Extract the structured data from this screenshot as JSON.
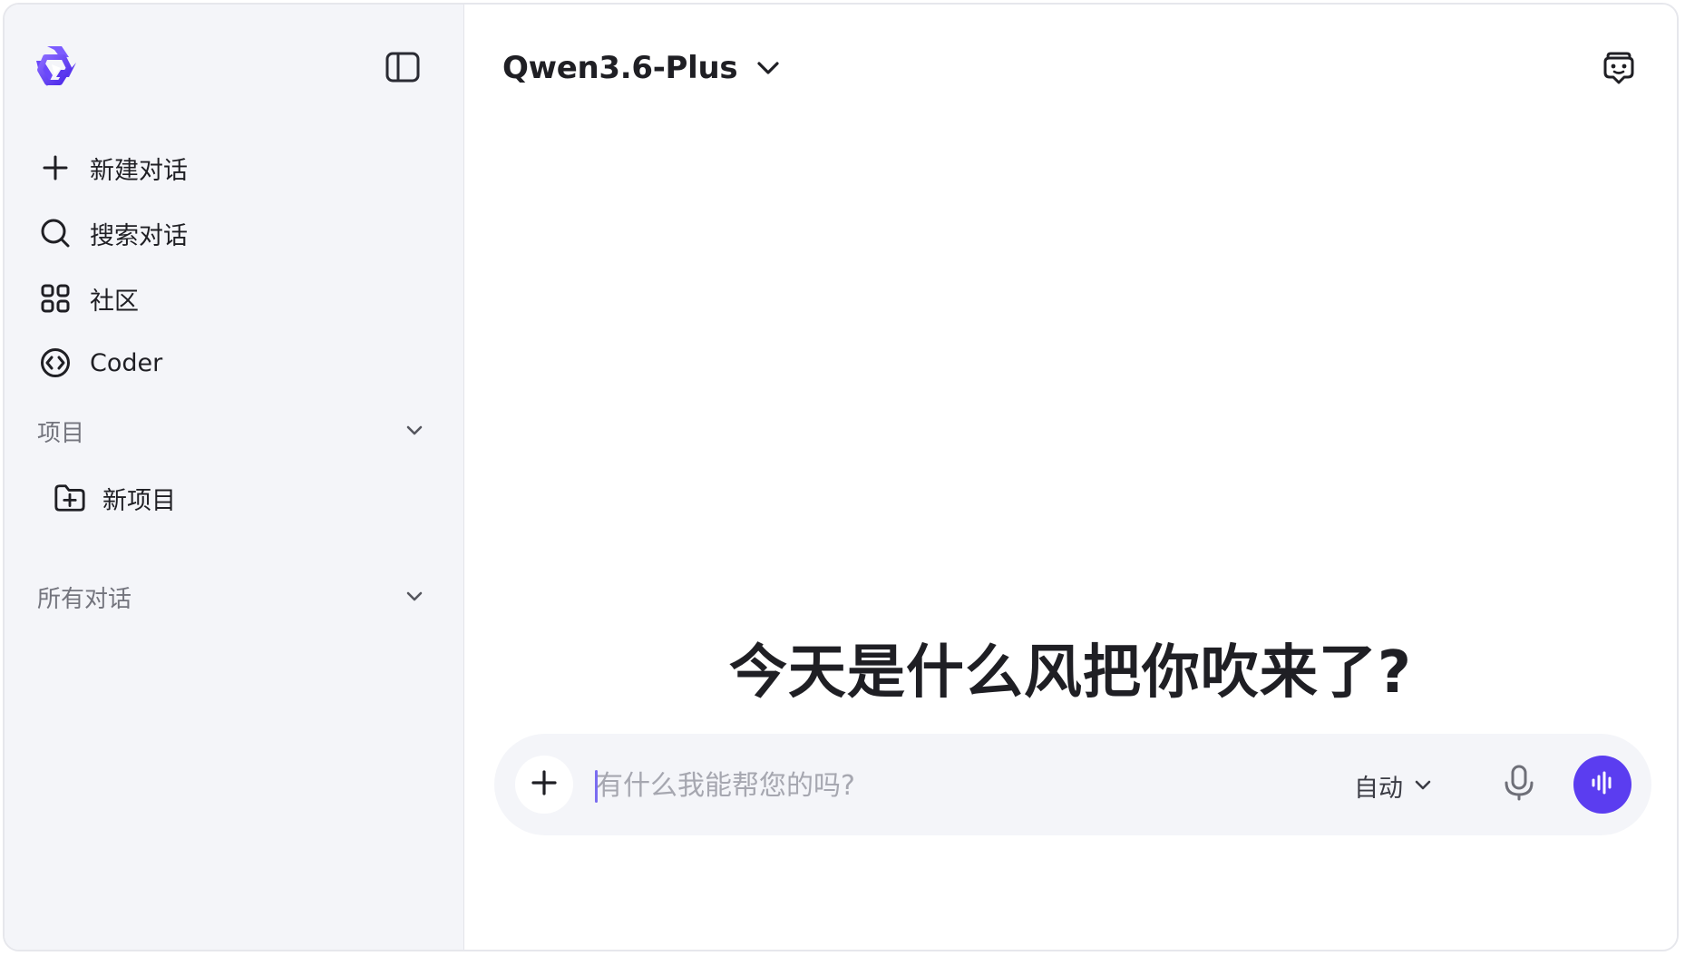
{
  "brand": {
    "accent_color": "#5b3df0",
    "logo_icon": "qwen-logo-icon"
  },
  "sidebar": {
    "collapse_icon": "sidebar-toggle-icon",
    "nav": [
      {
        "label": "新建对话",
        "icon": "plus-icon"
      },
      {
        "label": "搜索对话",
        "icon": "search-icon"
      },
      {
        "label": "社区",
        "icon": "grid-icon"
      },
      {
        "label": "Coder",
        "icon": "code-circle-icon"
      }
    ],
    "projects": {
      "label": "项目",
      "new_project": {
        "label": "新项目",
        "icon": "folder-plus-icon"
      }
    },
    "all_chats": {
      "label": "所有对话"
    }
  },
  "header": {
    "model_name": "Qwen3.6-Plus",
    "right_icon": "chat-bot-icon"
  },
  "main": {
    "greeting": "今天是什么风把你吹来了?"
  },
  "composer": {
    "placeholder": "有什么我能帮您的吗?",
    "value": "",
    "mode_label": "自动",
    "attach_icon": "plus-icon",
    "mic_icon": "microphone-icon",
    "voice_icon": "voice-wave-icon"
  }
}
